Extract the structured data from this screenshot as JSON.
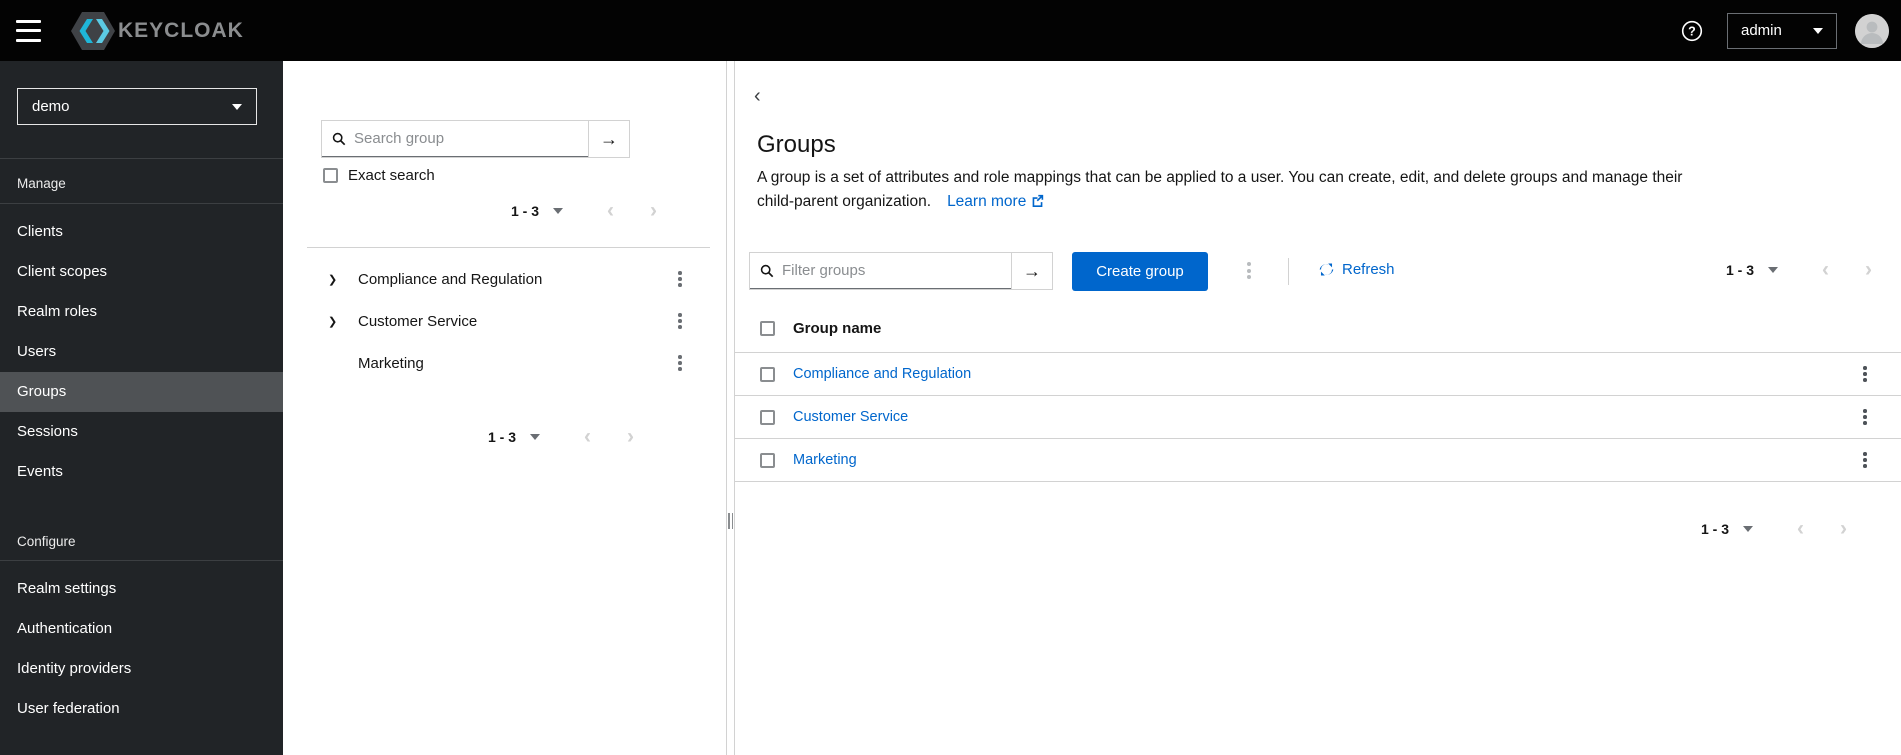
{
  "masthead": {
    "brand_text": "KEYCLOAK",
    "user": "admin"
  },
  "sidebar": {
    "realm": "demo",
    "manage_label": "Manage",
    "manage_items": [
      "Clients",
      "Client scopes",
      "Realm roles",
      "Users",
      "Groups",
      "Sessions",
      "Events"
    ],
    "active_item": "Groups",
    "configure_label": "Configure",
    "configure_items": [
      "Realm settings",
      "Authentication",
      "Identity providers",
      "User federation"
    ]
  },
  "tree_panel": {
    "search_placeholder": "Search group",
    "exact_search": "Exact search",
    "pagination_top": "1 - 3",
    "pagination_bottom": "1 - 3",
    "groups": [
      "Compliance and Regulation",
      "Customer Service",
      "Marketing"
    ]
  },
  "main": {
    "title": "Groups",
    "description": "A group is a set of attributes and role mappings that can be applied to a user. You can create, edit, and delete groups and manage their",
    "description_line2": "child-parent organization.",
    "learn_more": "Learn more",
    "filter_placeholder": "Filter groups",
    "create_group": "Create group",
    "refresh": "Refresh",
    "pagination_top": "1 - 3",
    "pagination_bottom": "1 - 3",
    "table": {
      "header": "Group name",
      "rows": [
        "Compliance and Regulation",
        "Customer Service",
        "Marketing"
      ]
    }
  },
  "icons": {
    "arrow_right": "→",
    "angle_left": "‹",
    "angle_right": "›",
    "back": "‹",
    "expand": "❯"
  },
  "colors": {
    "accent": "#0066cc",
    "masthead_bg": "#030303",
    "sidebar_bg": "#212427",
    "active_item_bg": "#4f5255",
    "link": "#0066cc"
  }
}
